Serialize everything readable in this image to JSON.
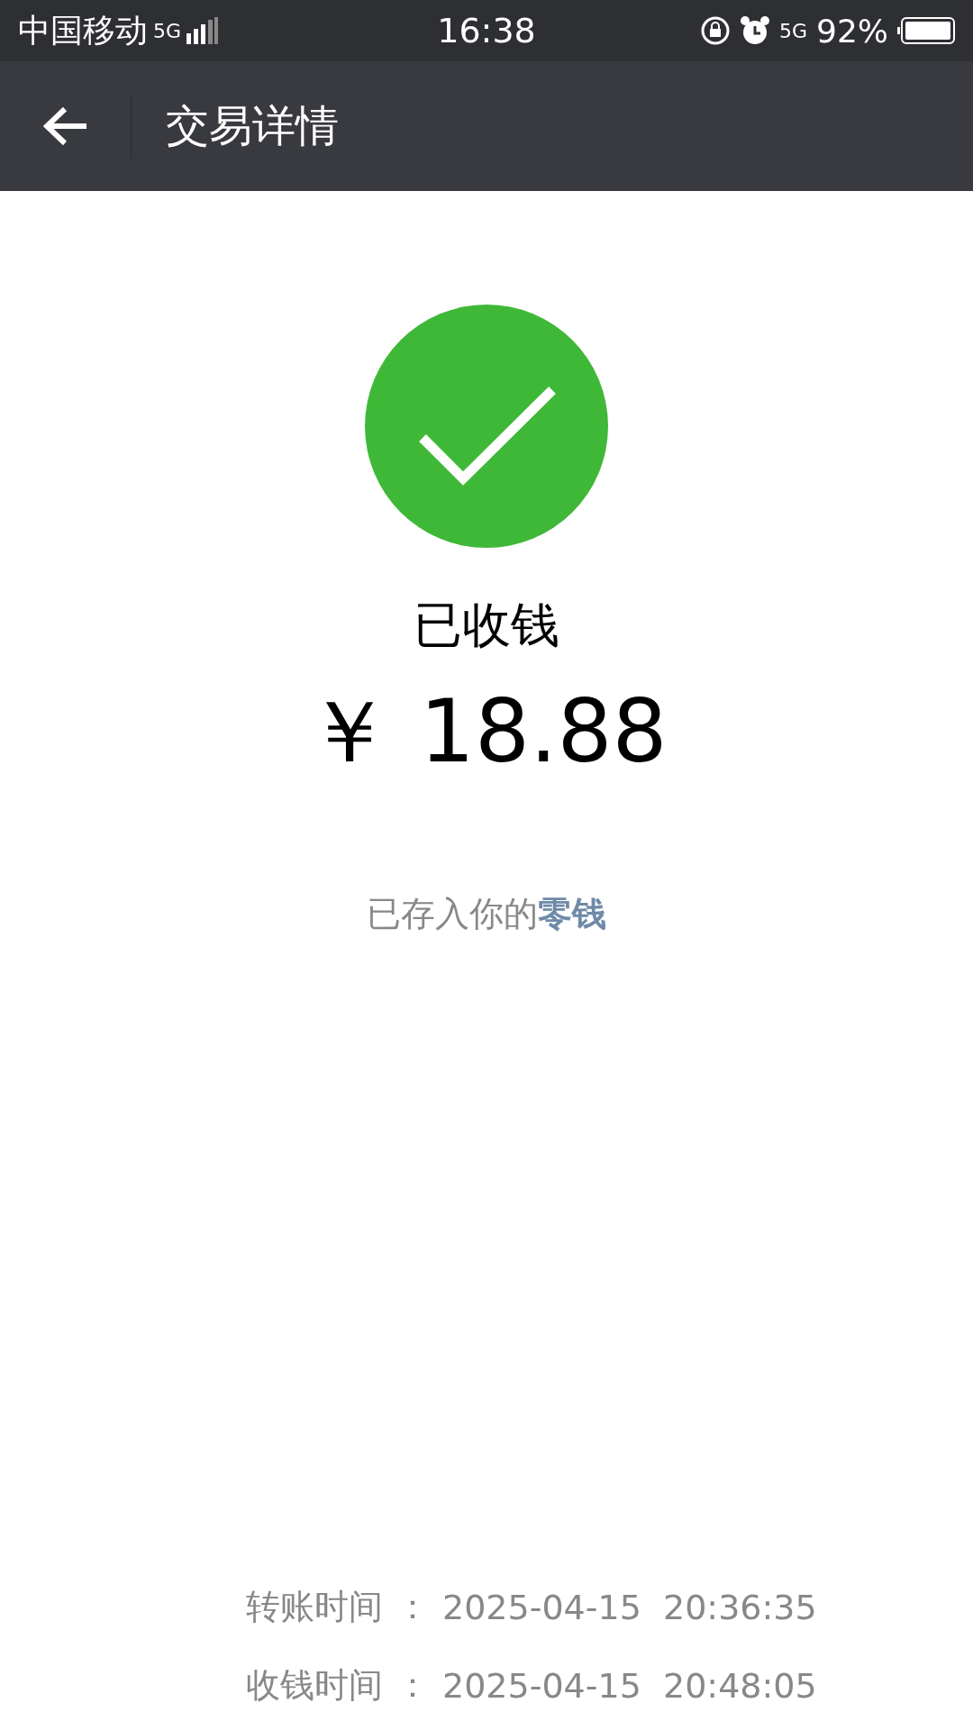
{
  "status_bar": {
    "carrier": "中国移动",
    "network": "5G",
    "time": "16:38",
    "network_right": "5G",
    "battery": "92%"
  },
  "nav_bar": {
    "title": "交易详情"
  },
  "result": {
    "status": "已收钱",
    "amount": "￥ 18.88",
    "note": "已存入你的",
    "note_link": "零钱"
  },
  "details": [
    {
      "label": "转账时间",
      "separator": "：",
      "value": "2025-04-15  20:36:35"
    },
    {
      "label": "收钱时间",
      "separator": "：",
      "value": "2025-04-15  20:48:05"
    }
  ]
}
